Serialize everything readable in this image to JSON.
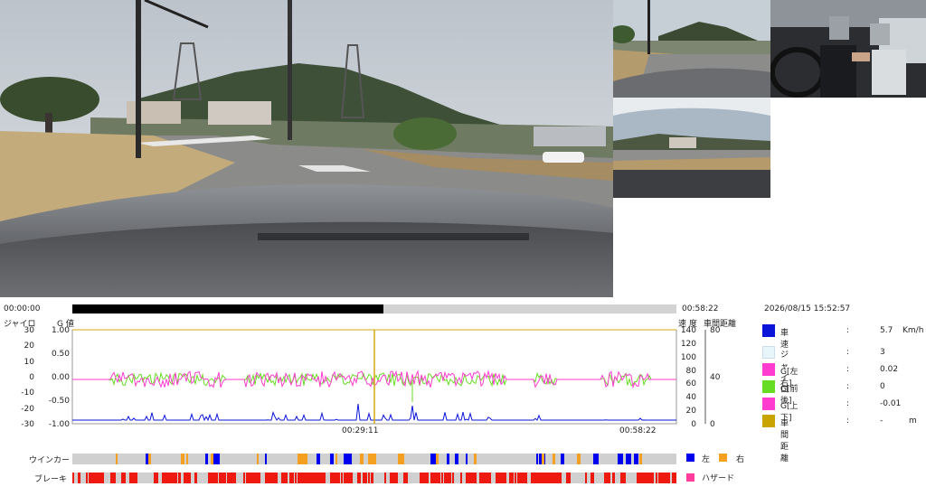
{
  "timeline": {
    "start": "00:00:00",
    "end": "00:58:22",
    "progress": 0.515
  },
  "datetime": "2026/08/15 15:52:57",
  "chart_left": {
    "gyro_label": "ジャイロ",
    "g_label": "G 値",
    "gyro_ticks": [
      "30",
      "20",
      "10",
      "0",
      "-10",
      "-20",
      "-30"
    ],
    "g_ticks": [
      "1.00",
      "0.50",
      "0.00",
      "-0.50",
      "-1.00"
    ]
  },
  "chart_right": {
    "speed_label": "速 度",
    "distance_label": "車間距離",
    "speed_ticks": [
      "140",
      "120",
      "100",
      "80",
      "60",
      "40",
      "20",
      "0"
    ],
    "distance_ticks": [
      "80",
      "40",
      "0"
    ]
  },
  "x_axis": {
    "mid": "00:29:11",
    "end": "00:58:22",
    "cursor": 0.5
  },
  "legend": [
    {
      "name": "車速",
      "colon": ":",
      "value": "5.7",
      "unit": "Km/h",
      "color": "#0a14d8"
    },
    {
      "name": "ジャイロ",
      "colon": ":",
      "value": "3",
      "unit": "",
      "color": "#e6f6fb"
    },
    {
      "name": "G[左右]",
      "colon": ":",
      "value": "0.02",
      "unit": "",
      "color": "#ff3ccf"
    },
    {
      "name": "G[前後]",
      "colon": ":",
      "value": "0",
      "unit": "",
      "color": "#66dd22"
    },
    {
      "name": "G[上下]",
      "colon": ":",
      "value": "-0.01",
      "unit": "",
      "color": "#ff3ccf"
    },
    {
      "name": "車間距離",
      "colon": ":",
      "value": "-",
      "unit": "m",
      "color": "#c9a400"
    }
  ],
  "winker": {
    "label": "ウインカー",
    "left_label": "左",
    "right_label": "右",
    "left_color": "#0000ee",
    "right_color": "#f4a020"
  },
  "brake": {
    "label": "ブレーキ",
    "hazard_label": "ハザード",
    "brake_color": "#ee1a10",
    "hazard_color": "#ff3c9b"
  },
  "video_labels": {
    "main": "front-camera",
    "rear_right": "driver-camera",
    "rear": "rear-camera"
  }
}
